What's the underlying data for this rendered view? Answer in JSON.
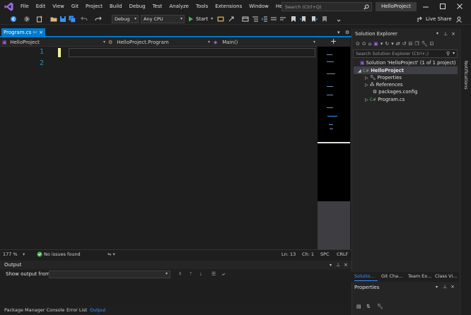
{
  "window": {
    "title": "HelloProject",
    "search_placeholder": "Search (Ctrl+Q)",
    "menu": [
      "File",
      "Edit",
      "View",
      "Git",
      "Project",
      "Build",
      "Debug",
      "Test",
      "Analyze",
      "Tools",
      "Extensions",
      "Window",
      "Help"
    ]
  },
  "toolbar": {
    "config": "Debug",
    "platform": "Any CPU",
    "start_label": "Start",
    "live_share_label": "Live Share"
  },
  "editor": {
    "tab_label": "Program.cs",
    "tab_close": "×",
    "nav_project": "HelloProject",
    "nav_class": "HelloProject.Program",
    "nav_member": "Main()",
    "line_numbers": [
      "1",
      "2"
    ],
    "zoom": "177 %",
    "issues": "No issues found",
    "line": "Ln: 13",
    "col": "Ch: 1",
    "spc": "SPC",
    "eol": "CRLF"
  },
  "output": {
    "title": "Output",
    "show_from_label": "Show output from:",
    "tabs": [
      "Package Manager Console",
      "Error List",
      "Output"
    ]
  },
  "solution_explorer": {
    "title": "Solution Explorer",
    "search_placeholder": "Search Solution Explorer (Ctrl+;)",
    "solution_label": "Solution 'HelloProject' (1 of 1 project)",
    "project_label": "HelloProject",
    "items": [
      "Properties",
      "References",
      "packages.config",
      "Program.cs"
    ],
    "tabs": [
      "Solutio...",
      "Git Cha...",
      "Team Ex...",
      "Class Vi..."
    ]
  },
  "properties": {
    "title": "Properties"
  },
  "notifications": {
    "label": "Notifications"
  },
  "colors": {
    "accent": "#007acc",
    "line_number": "#2b91af",
    "change_marker": "#efef9a",
    "ok_green": "#3fb950",
    "csharp_green": "#6aab73",
    "project_purple": "#9b5fe0"
  }
}
